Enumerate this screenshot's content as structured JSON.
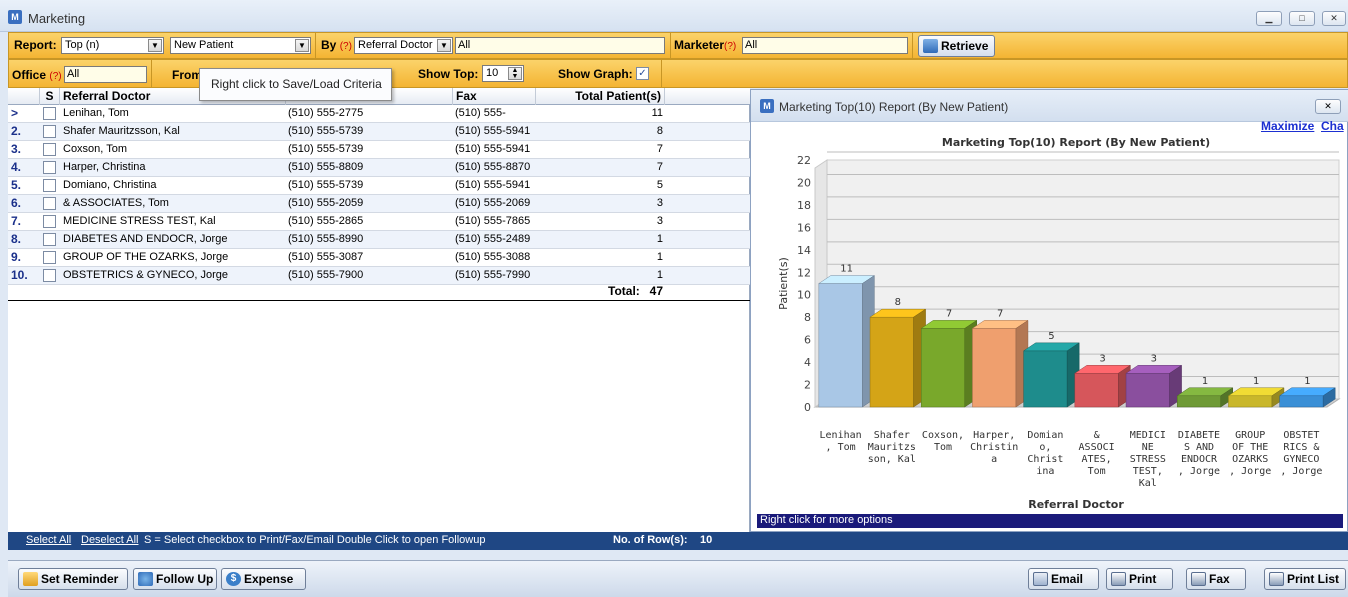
{
  "window": {
    "title": "Marketing",
    "minimize": "▁",
    "restore": "□",
    "close": "✕"
  },
  "criteria": {
    "report_label": "Report:",
    "report_value": "Top (n)",
    "report_type_value": "New Patient",
    "by_label": "By",
    "help_marker": "(?)",
    "by_value": "Referral Doctor",
    "by_filter_value": "All",
    "marketer_label": "Marketer",
    "marketer_value": "All",
    "retrieve_label": "Retrieve",
    "office_label": "Office",
    "office_value": "All",
    "from_label": "From",
    "show_top_label": "Show Top:",
    "show_top_value": "10",
    "show_graph_label": "Show Graph:",
    "show_graph_checked": "✓"
  },
  "tooltip": "Right click to Save/Load Criteria",
  "grid": {
    "columns": {
      "s": "S",
      "doctor": "Referral Doctor",
      "phone": "",
      "fax": "Fax",
      "total": "Total Patient(s)"
    },
    "rows": [
      {
        "num": ">",
        "doctor": "Lenihan, Tom",
        "phone": "(510) 555-2775",
        "fax": "(510) 555-",
        "total": "11"
      },
      {
        "num": "2.",
        "doctor": "Shafer Mauritzsson, Kal",
        "phone": "(510) 555-5739",
        "fax": "(510) 555-5941",
        "total": "8"
      },
      {
        "num": "3.",
        "doctor": "Coxson, Tom",
        "phone": "(510) 555-5739",
        "fax": "(510) 555-5941",
        "total": "7"
      },
      {
        "num": "4.",
        "doctor": "Harper, Christina",
        "phone": "(510) 555-8809",
        "fax": "(510) 555-8870",
        "total": "7"
      },
      {
        "num": "5.",
        "doctor": "Domiano, Christina",
        "phone": "(510) 555-5739",
        "fax": "(510) 555-5941",
        "total": "5"
      },
      {
        "num": "6.",
        "doctor": "& ASSOCIATES, Tom",
        "phone": "(510) 555-2059",
        "fax": "(510) 555-2069",
        "total": "3"
      },
      {
        "num": "7.",
        "doctor": "MEDICINE STRESS TEST, Kal",
        "phone": "(510) 555-2865",
        "fax": "(510) 555-7865",
        "total": "3"
      },
      {
        "num": "8.",
        "doctor": " DIABETES AND ENDOCR, Jorge",
        "phone": "(510) 555-8990",
        "fax": "(510) 555-2489",
        "total": "1"
      },
      {
        "num": "9.",
        "doctor": " GROUP OF THE OZARKS, Jorge",
        "phone": "(510) 555-3087",
        "fax": "(510) 555-3088",
        "total": "1"
      },
      {
        "num": "10.",
        "doctor": " OBSTETRICS & GYNECO, Jorge",
        "phone": "(510) 555-7900",
        "fax": "(510) 555-7990",
        "total": "1"
      }
    ],
    "total_label": "Total:",
    "total_value": "47"
  },
  "status": {
    "select_all": "Select All",
    "deselect_all": "Deselect All",
    "hint": "S = Select checkbox to Print/Fax/Email   Double Click to open Followup",
    "rows_label": "No. of Row(s):",
    "rows_value": "10"
  },
  "buttons": {
    "set_reminder": "Set Reminder",
    "follow_up": "Follow Up",
    "expense": "Expense",
    "email": "Email",
    "print": "Print",
    "fax": "Fax",
    "print_list": "Print List"
  },
  "chart_window": {
    "title": "Marketing Top(10) Report (By New Patient)",
    "maximize": "Maximize",
    "cha": "Cha",
    "footer": "Right click for more options"
  },
  "chart_data": {
    "type": "bar",
    "title": "Marketing Top(10) Report (By New Patient)",
    "xlabel": "Referral Doctor",
    "ylabel": "Patient(s)",
    "ylim": [
      0,
      22
    ],
    "yticks": [
      0,
      2,
      4,
      6,
      8,
      10,
      12,
      14,
      16,
      18,
      20,
      22
    ],
    "categories": [
      [
        "Lenihan",
        ", Tom"
      ],
      [
        "Shafer",
        "Mauritzs",
        "son, Kal"
      ],
      [
        "Coxson,",
        "Tom"
      ],
      [
        "Harper,",
        "Christin",
        "a"
      ],
      [
        "Domian",
        "o,",
        "Christ",
        "ina"
      ],
      [
        "&",
        "ASSOCI",
        "ATES,",
        "Tom"
      ],
      [
        "MEDICI",
        "NE",
        "STRESS",
        "TEST,",
        "Kal"
      ],
      [
        "DIABETE",
        "S AND",
        "ENDOCR",
        ", Jorge"
      ],
      [
        "GROUP",
        "OF THE",
        "OZARKS",
        ", Jorge"
      ],
      [
        "OBSTET",
        "RICS &",
        "GYNECO",
        ", Jorge"
      ]
    ],
    "values": [
      11,
      8,
      7,
      7,
      5,
      3,
      3,
      1,
      1,
      1
    ],
    "colors": [
      "#a9c7e6",
      "#d4a417",
      "#79a82b",
      "#ef9f6e",
      "#1e8c8c",
      "#d6565b",
      "#8a4f9e",
      "#6f9a36",
      "#c9b72b",
      "#3a8fd6"
    ],
    "grid": true,
    "legend": "none"
  }
}
